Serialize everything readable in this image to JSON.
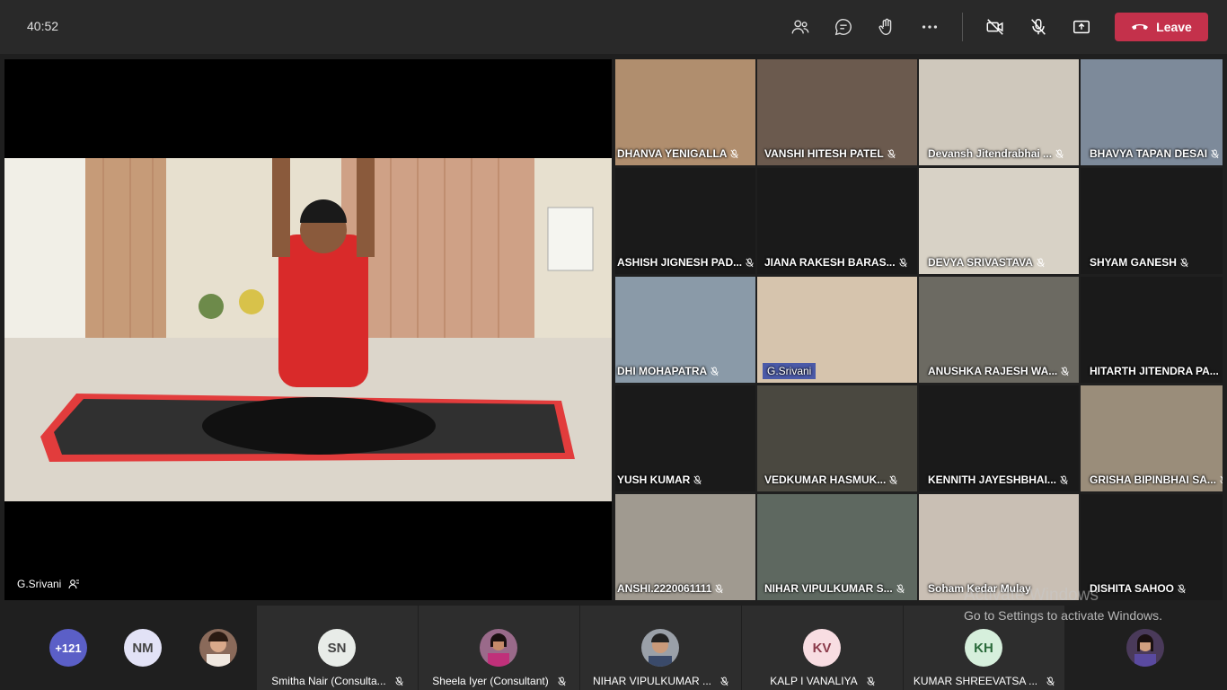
{
  "toolbar": {
    "timer": "40:52",
    "icons": [
      "participants-icon",
      "chat-icon",
      "raise-hand-icon",
      "more-icon",
      "camera-off-icon",
      "mic-off-icon",
      "share-icon"
    ],
    "leave_label": "Leave",
    "leave_color": "#c4314b"
  },
  "stage": {
    "name": "G.Srivani"
  },
  "grid": {
    "tiles": [
      {
        "name": "DHANVA YENIGALLA"
      },
      {
        "name": "VANSHI HITESH PATEL"
      },
      {
        "name": "Devansh Jitendrabhai ..."
      },
      {
        "name": "BHAVYA TAPAN DESAI"
      },
      {
        "name": "ASHISH JIGNESH PAD..."
      },
      {
        "name": "JIANA RAKESH BARAS..."
      },
      {
        "name": "DEVYA SRIVASTAVA"
      },
      {
        "name": "SHYAM GANESH"
      },
      {
        "name": "DHI MOHAPATRA"
      },
      {
        "name": "G.Srivani"
      },
      {
        "name": "ANUSHKA RAJESH WA..."
      },
      {
        "name": "HITARTH JITENDRA PA..."
      },
      {
        "name": "YUSH KUMAR"
      },
      {
        "name": "VEDKUMAR HASMUK..."
      },
      {
        "name": "KENNITH JAYESHBHAI..."
      },
      {
        "name": "GRISHA BIPINBHAI SA..."
      },
      {
        "name": "ANSHI.2220061111"
      },
      {
        "name": "NIHAR VIPULKUMAR S..."
      },
      {
        "name": "Soham Kedar Mulay"
      },
      {
        "name": "DISHITA SAHOO"
      }
    ]
  },
  "bottom": {
    "overflow_count": "+121",
    "nm_initials": "NM",
    "participants": [
      {
        "initials": "SN",
        "name": "Smitha Nair (Consulta..."
      },
      {
        "initials": "",
        "name": "Sheela Iyer (Consultant)"
      },
      {
        "initials": "",
        "name": "NIHAR VIPULKUMAR ..."
      },
      {
        "initials": "KV",
        "name": "KALP I VANALIYA"
      },
      {
        "initials": "KH",
        "name": "KUMAR SHREEVATSA ..."
      }
    ]
  },
  "watermark": {
    "title": "Activate Windows",
    "subtitle": "Go to Settings to activate Windows."
  }
}
